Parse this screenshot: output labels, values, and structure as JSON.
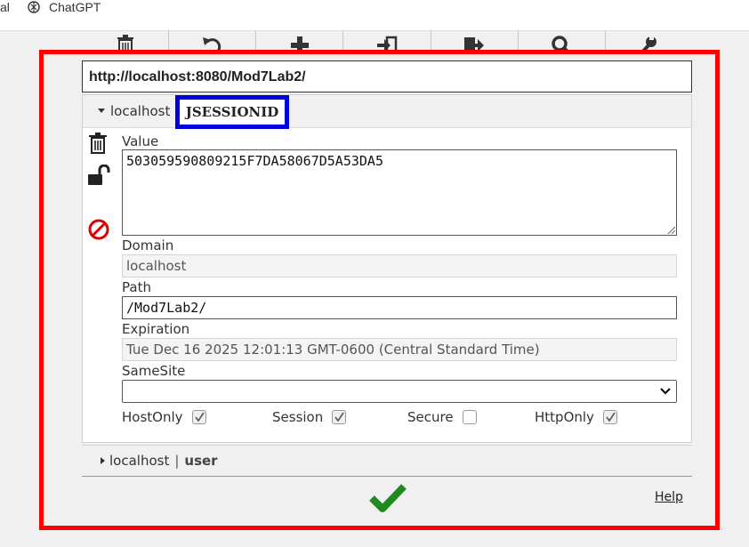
{
  "bookmarks": [
    {
      "label": "al",
      "icon": "partial-bookmark"
    },
    {
      "label": "ChatGPT",
      "icon": "chatgpt-logo-icon"
    }
  ],
  "toolbar": {
    "buttons": [
      {
        "name": "delete-all",
        "icon": "trash-icon"
      },
      {
        "name": "undo",
        "icon": "undo-icon"
      },
      {
        "name": "add",
        "icon": "plus-icon"
      },
      {
        "name": "import",
        "icon": "import-icon"
      },
      {
        "name": "export",
        "icon": "export-icon"
      },
      {
        "name": "search",
        "icon": "search-icon"
      },
      {
        "name": "options",
        "icon": "wrench-icon"
      }
    ]
  },
  "url": "http://localhost:8080/Mod7Lab2/",
  "cookies": [
    {
      "host": "localhost",
      "name": "JSESSIONID",
      "expanded": true,
      "value": "503059590809215F7DA58067D5A53DA5",
      "domain": "localhost",
      "path": "/Mod7Lab2/",
      "expiration": "Tue Dec 16 2025 12:01:13 GMT-0600 (Central Standard Time)",
      "samesite": "",
      "hostonly": true,
      "session": true,
      "secure": false,
      "httponly": true
    },
    {
      "host": "localhost",
      "separator": "|",
      "name": "user",
      "expanded": false
    }
  ],
  "labels": {
    "value": "Value",
    "domain": "Domain",
    "path": "Path",
    "expiration": "Expiration",
    "samesite": "SameSite",
    "hostonly": "HostOnly",
    "session": "Session",
    "secure": "Secure",
    "httponly": "HttpOnly"
  },
  "help_label": "Help",
  "colors": {
    "highlight_outer": "#ff0000",
    "highlight_name": "#0000dd",
    "delete_icon": "#dd0000",
    "confirm": "#1f8a1f"
  }
}
